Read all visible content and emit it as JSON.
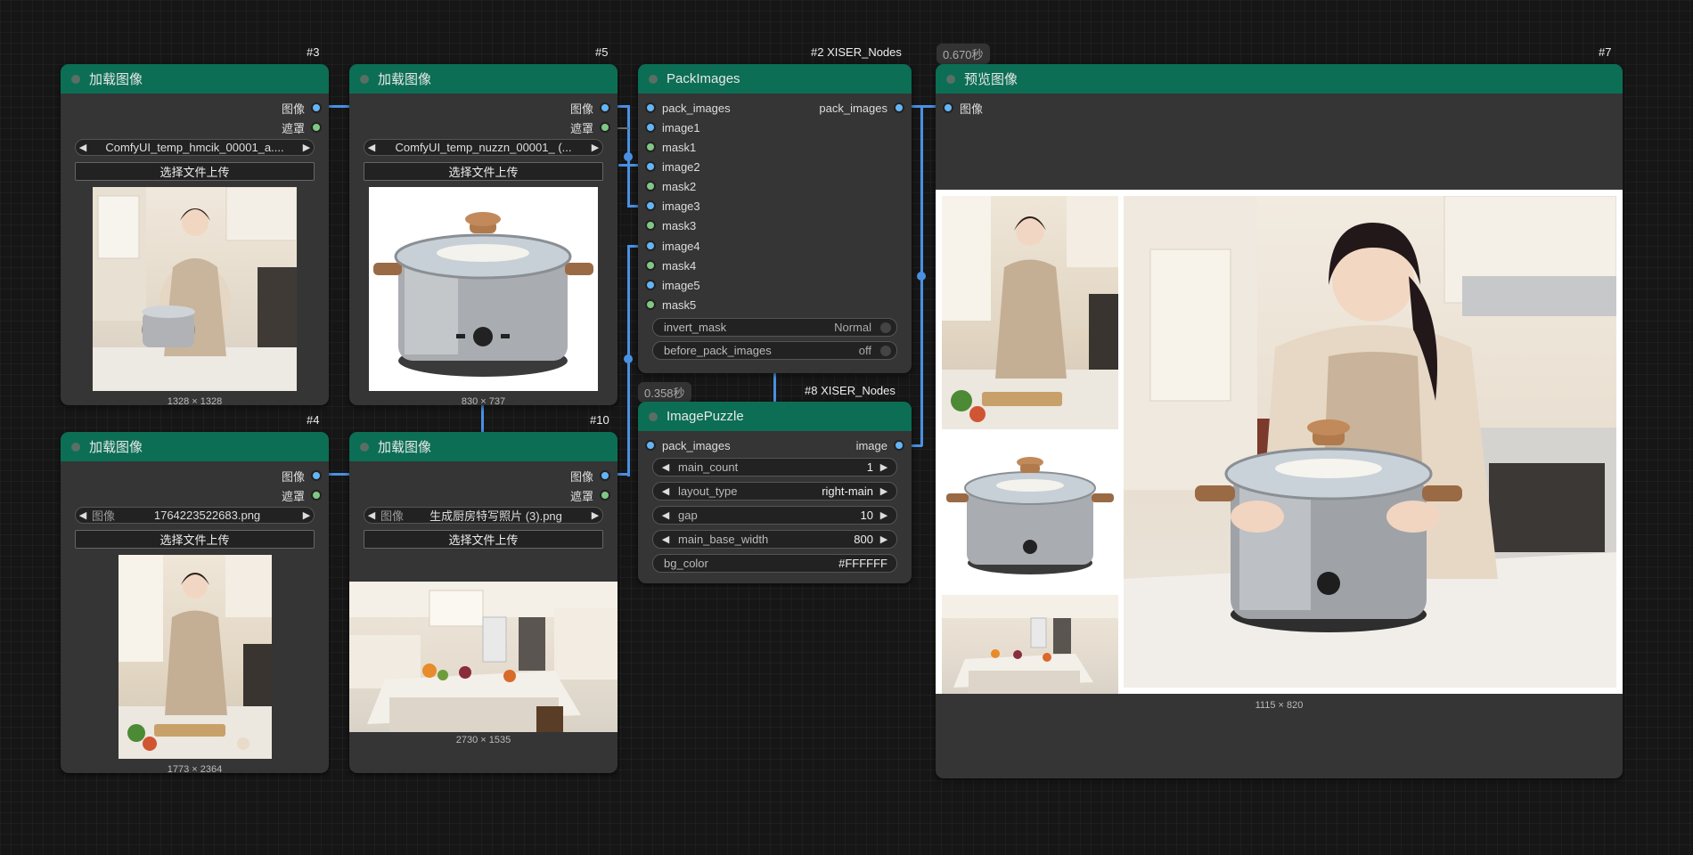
{
  "colors": {
    "node_header": "#0b6e55",
    "node_body": "#353535",
    "canvas": "#161616",
    "image_socket": "#64b5f6",
    "mask_socket": "#81c784",
    "wire": "#4a90e2"
  },
  "node3": {
    "id": "#3",
    "title": "加载图像",
    "out_image": "图像",
    "out_mask": "遮罩",
    "file": "ComfyUI_temp_hmcik_00001_a....",
    "upload": "选择文件上传",
    "dims": "1328 × 1328"
  },
  "node5": {
    "id": "#5",
    "title": "加载图像",
    "out_image": "图像",
    "out_mask": "遮罩",
    "file": "ComfyUI_temp_nuzzn_00001_ (...",
    "upload": "选择文件上传",
    "dims": "830 × 737"
  },
  "node4": {
    "id": "#4",
    "title": "加载图像",
    "out_image": "图像",
    "out_mask": "遮罩",
    "file_label": "图像",
    "file": "1764223522683.png",
    "upload": "选择文件上传",
    "dims": "1773 × 2364"
  },
  "node10": {
    "id": "#10",
    "title": "加载图像",
    "out_image": "图像",
    "out_mask": "遮罩",
    "file_label": "图像",
    "file": "生成厨房特写照片 (3).png",
    "upload": "选择文件上传",
    "dims": "2730 × 1535"
  },
  "node2": {
    "id": "#2 XISER_Nodes",
    "title": "PackImages",
    "inputs": [
      "pack_images",
      "image1",
      "mask1",
      "image2",
      "mask2",
      "image3",
      "mask3",
      "image4",
      "mask4",
      "image5",
      "mask5"
    ],
    "output": "pack_images",
    "invert_mask": {
      "label": "invert_mask",
      "value": "Normal"
    },
    "before_pack": {
      "label": "before_pack_images",
      "value": "off"
    }
  },
  "node8": {
    "id": "#8 XISER_Nodes",
    "time": "0.358秒",
    "title": "ImagePuzzle",
    "input": "pack_images",
    "output": "image",
    "widgets": [
      {
        "label": "main_count",
        "value": "1"
      },
      {
        "label": "layout_type",
        "value": "right-main"
      },
      {
        "label": "gap",
        "value": "10"
      },
      {
        "label": "main_base_width",
        "value": "800"
      },
      {
        "label": "bg_color",
        "value": "#FFFFFF"
      }
    ]
  },
  "node7": {
    "id": "#7",
    "time": "0.670秒",
    "title": "预览图像",
    "input": "图像",
    "dims": "1115 × 820"
  }
}
